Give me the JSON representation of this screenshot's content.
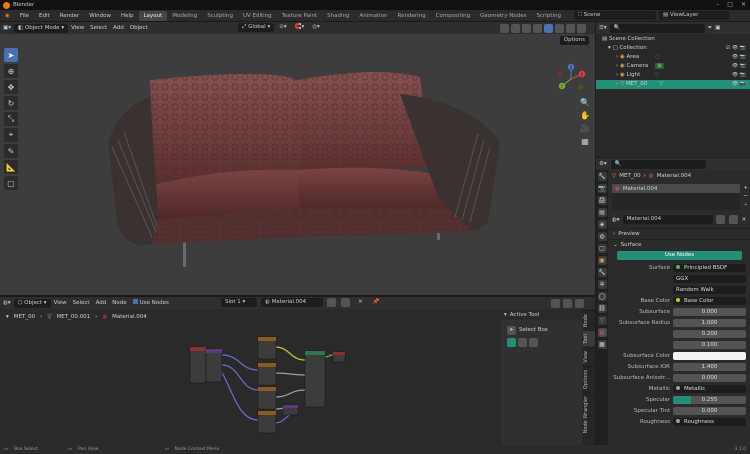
{
  "app": {
    "title": "Blender"
  },
  "menu": [
    "File",
    "Edit",
    "Render",
    "Window",
    "Help"
  ],
  "workspaces": [
    "Layout",
    "Modeling",
    "Sculpting",
    "UV Editing",
    "Texture Paint",
    "Shading",
    "Animation",
    "Rendering",
    "Compositing",
    "Geometry Nodes",
    "Scripting"
  ],
  "active_workspace": "Layout",
  "scene": {
    "name": "Scene",
    "view_layer": "ViewLayer"
  },
  "viewport": {
    "mode": "Object Mode",
    "menus": [
      "View",
      "Select",
      "Add",
      "Object"
    ],
    "orientation": "Global",
    "options_label": "Options",
    "gizmo_labels": {
      "x": "X",
      "y": "Y",
      "z": "Z"
    }
  },
  "node_editor": {
    "mode": "Object",
    "menus": [
      "View",
      "Select",
      "Add",
      "Node"
    ],
    "use_nodes_label": "Use Nodes",
    "slot": "Slot 1",
    "material": "Material.004",
    "breadcrumb": [
      "MET_00",
      "MET_00.001",
      "Material.004"
    ],
    "sidebar": {
      "title": "Active Tool",
      "tool": "Select Box"
    },
    "tabs": [
      "Node",
      "Tool",
      "View",
      "Options",
      "Node Wrangler"
    ]
  },
  "outliner": {
    "root": "Scene Collection",
    "items": [
      {
        "label": "Collection",
        "indent": 1
      },
      {
        "label": "Area",
        "indent": 2
      },
      {
        "label": "Camera",
        "indent": 2
      },
      {
        "label": "Light",
        "indent": 2
      },
      {
        "label": "MET_00",
        "indent": 2
      }
    ]
  },
  "properties": {
    "object_name": "MET_00",
    "material_name": "Material.004",
    "slot_name": "Material.004",
    "sections": {
      "preview": "Preview",
      "surface": "Surface"
    },
    "use_nodes_label": "Use Nodes",
    "rows": [
      {
        "label": "Surface",
        "value": "Principled BSDF",
        "kind": "dark",
        "dot": "#59b44f"
      },
      {
        "label": "",
        "value": "GGX",
        "kind": "dark"
      },
      {
        "label": "",
        "value": "Random Walk",
        "kind": "dark"
      },
      {
        "label": "Base Color",
        "value": "Base Color",
        "kind": "dark",
        "dot": "#c7c729"
      },
      {
        "label": "Subsurface",
        "value": "0.000",
        "kind": "num"
      },
      {
        "label": "Subsurface Radius",
        "value": "1.000",
        "kind": "num"
      },
      {
        "label": "",
        "value": "0.200",
        "kind": "num"
      },
      {
        "label": "",
        "value": "0.100",
        "kind": "num"
      },
      {
        "label": "Subsurface Color",
        "value": "",
        "kind": "white"
      },
      {
        "label": "Subsurface IOR",
        "value": "1.400",
        "kind": "num"
      },
      {
        "label": "Subsurface Anisotr...",
        "value": "0.000",
        "kind": "num"
      },
      {
        "label": "Metallic",
        "value": "Metallic",
        "kind": "dark",
        "dot": "#a1a1a1"
      },
      {
        "label": "Specular",
        "value": "0.255",
        "kind": "teal"
      },
      {
        "label": "Specular Tint",
        "value": "0.000",
        "kind": "num"
      },
      {
        "label": "Roughness",
        "value": "Roughness",
        "kind": "dark",
        "dot": "#a1a1a1"
      }
    ]
  },
  "status": {
    "left": "Box Select",
    "mid": "Pan View",
    "right": "Node Context Menu",
    "version": "3.1.0"
  },
  "colors": {
    "accent": "#4772b3",
    "active": "#238f78",
    "sofa": "#6b3a3a"
  }
}
